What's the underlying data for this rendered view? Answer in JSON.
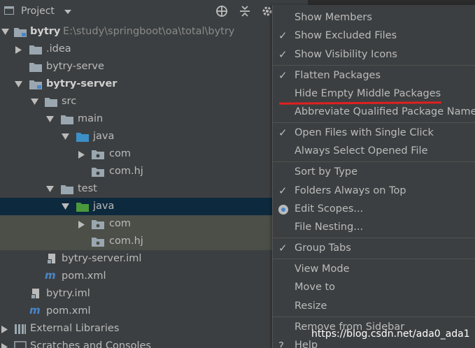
{
  "header": {
    "title": "Project"
  },
  "tree": [
    {
      "label": "bytry",
      "path": "E:\\study\\springboot\\oa\\total\\bytry",
      "bold": true
    },
    {
      "label": ".idea"
    },
    {
      "label": "bytry-serve"
    },
    {
      "label": "bytry-server",
      "bold": true
    },
    {
      "label": "src"
    },
    {
      "label": "main"
    },
    {
      "label": "java"
    },
    {
      "label": "com"
    },
    {
      "label": "com.hj"
    },
    {
      "label": "test"
    },
    {
      "label": "java"
    },
    {
      "label": "com"
    },
    {
      "label": "com.hj"
    },
    {
      "label": "bytry-server.iml"
    },
    {
      "label": "pom.xml"
    },
    {
      "label": "bytry.iml"
    },
    {
      "label": "pom.xml"
    },
    {
      "label": "External Libraries"
    },
    {
      "label": "Scratches and Consoles"
    }
  ],
  "menu": {
    "items": [
      {
        "label": "Show Members",
        "mark": ""
      },
      {
        "label": "Show Excluded Files",
        "mark": "check"
      },
      {
        "label": "Show Visibility Icons",
        "mark": "check"
      },
      {
        "label": "Flatten Packages",
        "mark": "check"
      },
      {
        "label": "Hide Empty Middle Packages",
        "mark": ""
      },
      {
        "label": "Abbreviate Qualified Package Names",
        "mark": ""
      },
      {
        "label": "Open Files with Single Click",
        "mark": "check"
      },
      {
        "label": "Always Select Opened File",
        "mark": ""
      },
      {
        "label": "Sort by Type",
        "mark": ""
      },
      {
        "label": "Folders Always on Top",
        "mark": "check"
      },
      {
        "label": "Edit Scopes...",
        "mark": "radio"
      },
      {
        "label": "File Nesting...",
        "mark": ""
      },
      {
        "label": "Group Tabs",
        "mark": "check"
      },
      {
        "label": "View Mode",
        "mark": ""
      },
      {
        "label": "Move to",
        "mark": ""
      },
      {
        "label": "Resize",
        "mark": ""
      },
      {
        "label": "Remove from Sidebar",
        "mark": ""
      },
      {
        "label": "Help",
        "mark": "help"
      }
    ]
  },
  "watermark": "https://blog.csdn.net/ada0_ada1",
  "colors": {
    "selection": "#0d293e",
    "highlight": "#4b4f48",
    "annotation": "#e02020"
  }
}
